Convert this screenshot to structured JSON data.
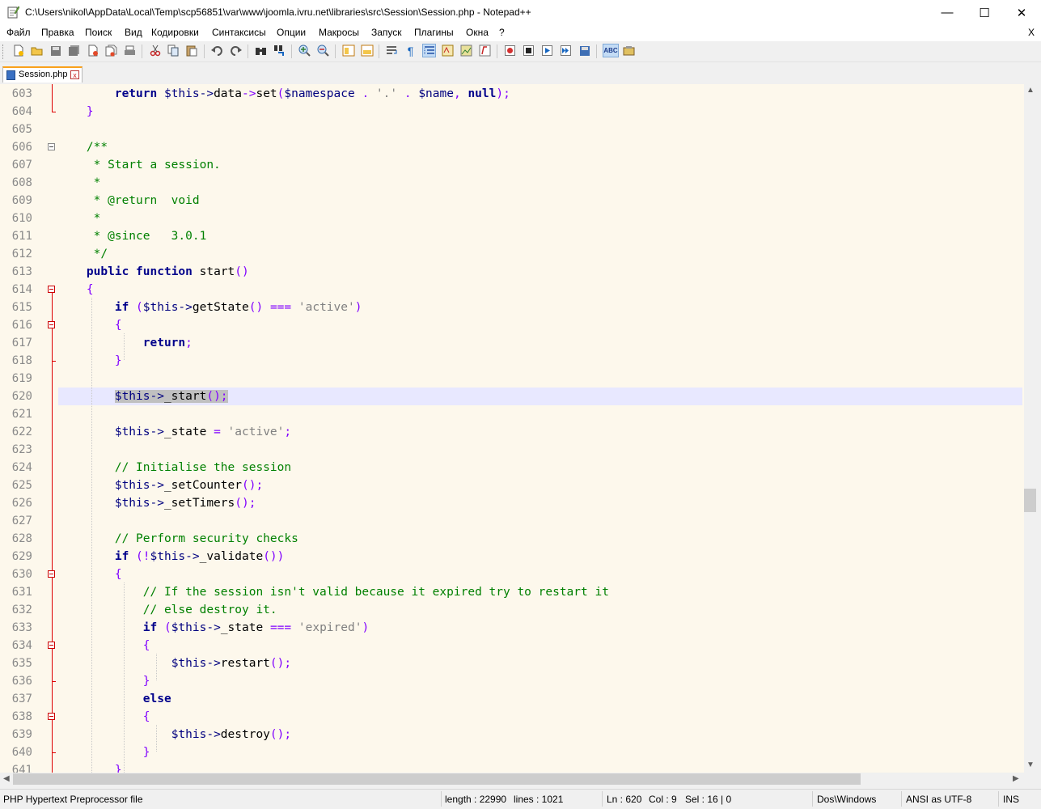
{
  "window": {
    "title": "C:\\Users\\nikol\\AppData\\Local\\Temp\\scp56851\\var\\www\\joomla.ivru.net\\libraries\\src\\Session\\Session.php - Notepad++",
    "minimize": "—",
    "maximize": "☐",
    "close": "✕"
  },
  "menu": {
    "items": [
      "Файл",
      "Правка",
      "Поиск",
      "Вид",
      "Кодировки",
      "Синтаксисы",
      "Опции",
      "Макросы",
      "Запуск",
      "Плагины",
      "Окна",
      "?"
    ],
    "close_doc": "X"
  },
  "tabs": [
    {
      "label": "Session.php",
      "close": "x"
    }
  ],
  "editor": {
    "current_line": 620,
    "line_numbers": [
      "603",
      "604",
      "605",
      "606",
      "607",
      "608",
      "609",
      "610",
      "611",
      "612",
      "613",
      "614",
      "615",
      "616",
      "617",
      "618",
      "619",
      "620",
      "621",
      "622",
      "623",
      "624",
      "625",
      "626",
      "627",
      "628",
      "629",
      "630",
      "631",
      "632",
      "633",
      "634",
      "635",
      "636",
      "637",
      "638",
      "639",
      "640",
      "641"
    ],
    "code": {
      "l603": [
        "return",
        "$this->",
        "data",
        "->",
        "set",
        "(",
        "$namespace",
        ".",
        "'.'",
        ".",
        "$name",
        ",",
        "null",
        ");"
      ],
      "l604": "}",
      "l606": "/**",
      "l607": " * Start a session.",
      "l608": " *",
      "l609": " * @return  void",
      "l610": " *",
      "l611": " * @since   3.0.1",
      "l612": " */",
      "l613": [
        "public",
        "function",
        "start",
        "()"
      ],
      "l614": "{",
      "l615": [
        "if",
        "(",
        "$this->",
        "getState",
        "()",
        "===",
        "'active'",
        ")"
      ],
      "l616": "{",
      "l617": [
        "return",
        ";"
      ],
      "l618": "}",
      "l620": [
        "$this->",
        "_start",
        "();"
      ],
      "l622": [
        "$this->",
        "_state",
        "=",
        "'active'",
        ";"
      ],
      "l624": "// Initialise the session",
      "l625": [
        "$this->",
        "_setCounter",
        "();"
      ],
      "l626": [
        "$this->",
        "_setTimers",
        "();"
      ],
      "l628": "// Perform security checks",
      "l629": [
        "if",
        "(!",
        "$this->",
        "_validate",
        "())"
      ],
      "l630": "{",
      "l631": "// If the session isn't valid because it expired try to restart it",
      "l632": "// else destroy it.",
      "l633": [
        "if",
        "(",
        "$this->",
        "_state",
        "===",
        "'expired'",
        ")"
      ],
      "l634": "{",
      "l635": [
        "$this->",
        "restart",
        "();"
      ],
      "l636": "}",
      "l637": "else",
      "l638": "{",
      "l639": [
        "$this->",
        "destroy",
        "();"
      ],
      "l640": "}",
      "l641": "}"
    }
  },
  "statusbar": {
    "file_type": "PHP Hypertext Preprocessor file",
    "length": "length : 22990",
    "lines": "lines : 1021",
    "ln": "Ln : 620",
    "col": "Col : 9",
    "sel": "Sel : 16 | 0",
    "eol": "Dos\\Windows",
    "encoding": "ANSI as UTF-8",
    "mode": "INS"
  },
  "colors": {
    "editor_bg": "#fdf8ec",
    "current_line": "#e8e8ff",
    "keyword": "#00008b",
    "variable": "#00007f",
    "operator": "#8000ff",
    "string": "#808080",
    "comment": "#008000",
    "fold_line": "#dd0000",
    "tab_accent": "#f9a11b"
  }
}
